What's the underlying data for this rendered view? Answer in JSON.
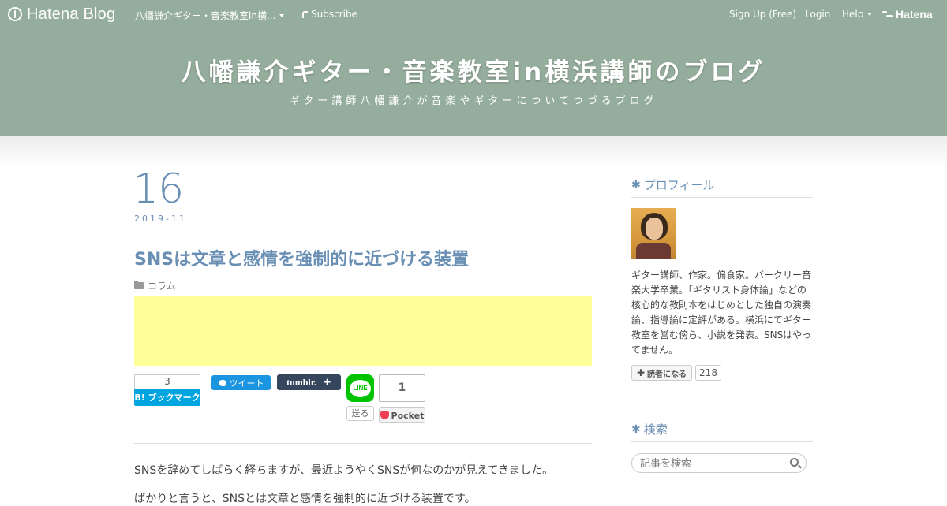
{
  "topbar": {
    "logo_text": "Hatena Blog",
    "blog_menu_label": "八幡謙介ギター・音楽教室in横...",
    "subscribe_label": "Subscribe",
    "signup_label": "Sign Up (Free)",
    "login_label": "Login",
    "help_label": "Help",
    "hatena_label": "Hatena"
  },
  "header": {
    "title": "八幡謙介ギター・音楽教室in横浜講師のブログ",
    "description": "ギター講師八幡謙介が音楽やギターについてつづるブログ",
    "background_color": "#95ad9c"
  },
  "entry": {
    "day": "16",
    "year_month": "2019-11",
    "title": "SNSは文章と感情を強制的に近づける装置",
    "category": "コラム",
    "ad_color": "#ffff99",
    "share": {
      "hatebu_count": "3",
      "hatebu_label": "B! ブックマーク",
      "tweet_label": "ツイート",
      "tumblr_label": "tumblr.",
      "tumblr_plus": "+",
      "line_label": "LINE",
      "line_send_label": "送る",
      "pocket_count": "1",
      "pocket_label": "Pocket"
    },
    "paragraphs": [
      "SNSを辞めてしばらく経ちますが、最近ようやくSNSが何なのかが見えてきました。",
      "ばかりと言うと、SNSとは文章と感情を強制的に近づける装置です。"
    ]
  },
  "sidebar": {
    "profile_title": "プロフィール",
    "profile_desc": "ギター講師、作家。偏食家。バークリー音楽大学卒業。「ギタリスト身体論」などの核心的な教則本をはじめとした独自の演奏論、指導論に定評がある。横浜にてギター教室を営む傍ら、小説を発表。SNSはやってません。",
    "follow_label": "読者になる",
    "follow_count": "218",
    "search_title": "検索",
    "search_placeholder": "記事を検索"
  },
  "colors": {
    "accent": "#6a8fb5",
    "hatebu": "#00a4de",
    "twitter": "#1b95e0",
    "tumblr": "#36465d",
    "line": "#00c300",
    "pocket": "#ef4056"
  }
}
